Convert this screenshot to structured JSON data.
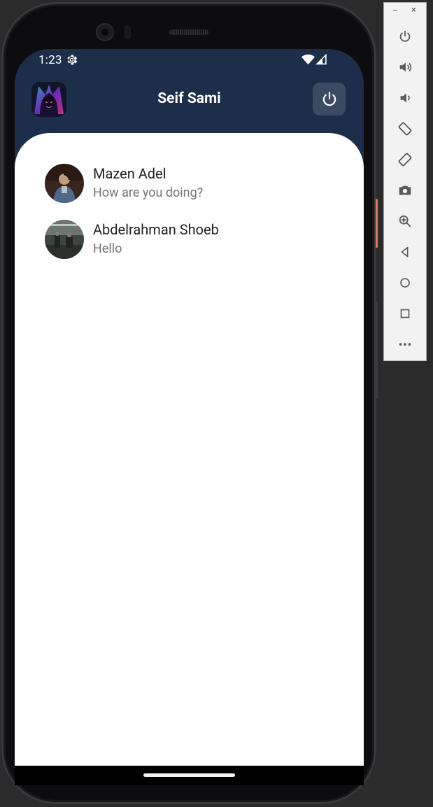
{
  "status_bar": {
    "time": "1:23"
  },
  "app_bar": {
    "title": "Seif Sami"
  },
  "chats": [
    {
      "name": "Mazen Adel",
      "last_message": "How are you doing?"
    },
    {
      "name": "Abdelrahman Shoeb",
      "last_message": "Hello"
    }
  ],
  "fab": {
    "label": "+"
  },
  "emulator": {
    "minimize": "–",
    "close": "×",
    "controls": [
      "power-icon",
      "volume-up-icon",
      "volume-down-icon",
      "rotate-left-icon",
      "rotate-right-icon",
      "camera-icon",
      "zoom-icon",
      "back-icon",
      "home-icon",
      "overview-icon",
      "more-icon"
    ]
  },
  "colors": {
    "app_bar": "#1c2e4a",
    "sheet": "#ffffff",
    "logout_button": "#3c4b64",
    "fab": "#1c2e4a",
    "accent_orange": "#e8765a"
  }
}
